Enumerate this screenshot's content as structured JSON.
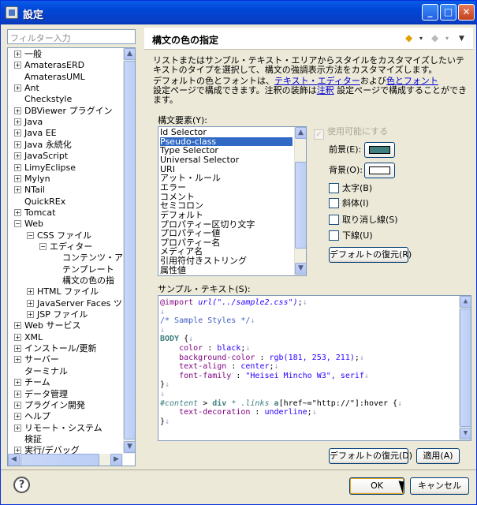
{
  "window": {
    "title": "設定",
    "buttons": {
      "minimize": "_",
      "maximize": "□",
      "close": "✕"
    }
  },
  "filter": {
    "placeholder": "フィルター入力"
  },
  "tree": {
    "items": [
      {
        "label": "一般",
        "expander": "+"
      },
      {
        "label": "AmaterasERD",
        "expander": "+"
      },
      {
        "label": "AmaterasUML",
        "expander": ""
      },
      {
        "label": "Ant",
        "expander": "+"
      },
      {
        "label": "Checkstyle",
        "expander": ""
      },
      {
        "label": "DBViewer プラグイン",
        "expander": "+"
      },
      {
        "label": "Java",
        "expander": "+"
      },
      {
        "label": "Java EE",
        "expander": "+"
      },
      {
        "label": "Java 永続化",
        "expander": "+"
      },
      {
        "label": "JavaScript",
        "expander": "+"
      },
      {
        "label": "LimyEclipse",
        "expander": "+"
      },
      {
        "label": "Mylyn",
        "expander": "+"
      },
      {
        "label": "NTail",
        "expander": "+"
      },
      {
        "label": "QuickREx",
        "expander": ""
      },
      {
        "label": "Tomcat",
        "expander": "+"
      },
      {
        "label": "Web",
        "expander": "−"
      },
      {
        "label": "CSS ファイル",
        "expander": "−"
      },
      {
        "label": "エディター",
        "expander": "−"
      },
      {
        "label": "コンテンツ・アシ",
        "expander": ""
      },
      {
        "label": "テンプレート",
        "expander": ""
      },
      {
        "label": "構文の色の指",
        "expander": ""
      },
      {
        "label": "HTML ファイル",
        "expander": "+"
      },
      {
        "label": "JavaServer Faces ツ",
        "expander": "+"
      },
      {
        "label": "JSP ファイル",
        "expander": "+"
      },
      {
        "label": "Web サービス",
        "expander": "+"
      },
      {
        "label": "XML",
        "expander": "+"
      },
      {
        "label": "インストール/更新",
        "expander": "+"
      },
      {
        "label": "サーバー",
        "expander": "+"
      },
      {
        "label": "ターミナル",
        "expander": ""
      },
      {
        "label": "チーム",
        "expander": "+"
      },
      {
        "label": "データ管理",
        "expander": "+"
      },
      {
        "label": "プラグイン開発",
        "expander": "+"
      },
      {
        "label": "ヘルプ",
        "expander": "+"
      },
      {
        "label": "リモート・システム",
        "expander": "+"
      },
      {
        "label": "検証",
        "expander": ""
      },
      {
        "label": "実行/デバッグ",
        "expander": "+"
      }
    ]
  },
  "header": {
    "title": "構文の色の指定",
    "back_icon": "◆",
    "fwd_icon": "◆",
    "dropdown_icon": "▾",
    "menu_icon": "▼"
  },
  "description": {
    "line1": "リストまたはサンプル・テキスト・エリアからスタイルをカスタマイズしたいテキストのタイプを選択して、構文の強調表示方法をカスタマイズします。",
    "line2_a": "デフォルトの色とフォントは、",
    "line2_link1": "テキスト・エディター",
    "line2_b": "および",
    "line2_link2": "色とフォント",
    "line3_a": "設定ページで構成できます。注釈の装飾は",
    "line3_link": "注釈",
    "line3_b": " 設定ページで構成することができます。"
  },
  "syntax_elements": {
    "label": "構文要素(Y):",
    "items": [
      "Id Selector",
      "Pseudo-class",
      "Type Selector",
      "Universal Selector",
      "URI",
      "アット・ルール",
      "エラー",
      "コメント",
      "セミコロン",
      "デフォルト",
      "プロパティー区切り文字",
      "プロパティー値",
      "プロパティー名",
      "メディア名",
      "引用符付きストリング",
      "属性値"
    ],
    "selected_index": 1
  },
  "style_options": {
    "enable_label": "使用可能にする",
    "foreground_label": "前景(E):",
    "background_label": "背景(O):",
    "foreground_color": "#3f7f7f",
    "background_color": "#ffffff",
    "bold_label": "太字(B)",
    "italic_label": "斜体(I)",
    "strike_label": "取り消し線(S)",
    "underline_label": "下線(U)",
    "restore_label": "デフォルトの復元(R)"
  },
  "sample": {
    "label": "サンプル・テキスト(S):",
    "eol": "↓"
  },
  "footer": {
    "restore_defaults": "デフォルトの復元(D)",
    "apply": "適用(A)",
    "ok": "OK",
    "cancel": "キャンセル",
    "help": "?"
  },
  "scroll": {
    "up": "▲",
    "down": "▼",
    "left": "◀",
    "right": "▶"
  }
}
